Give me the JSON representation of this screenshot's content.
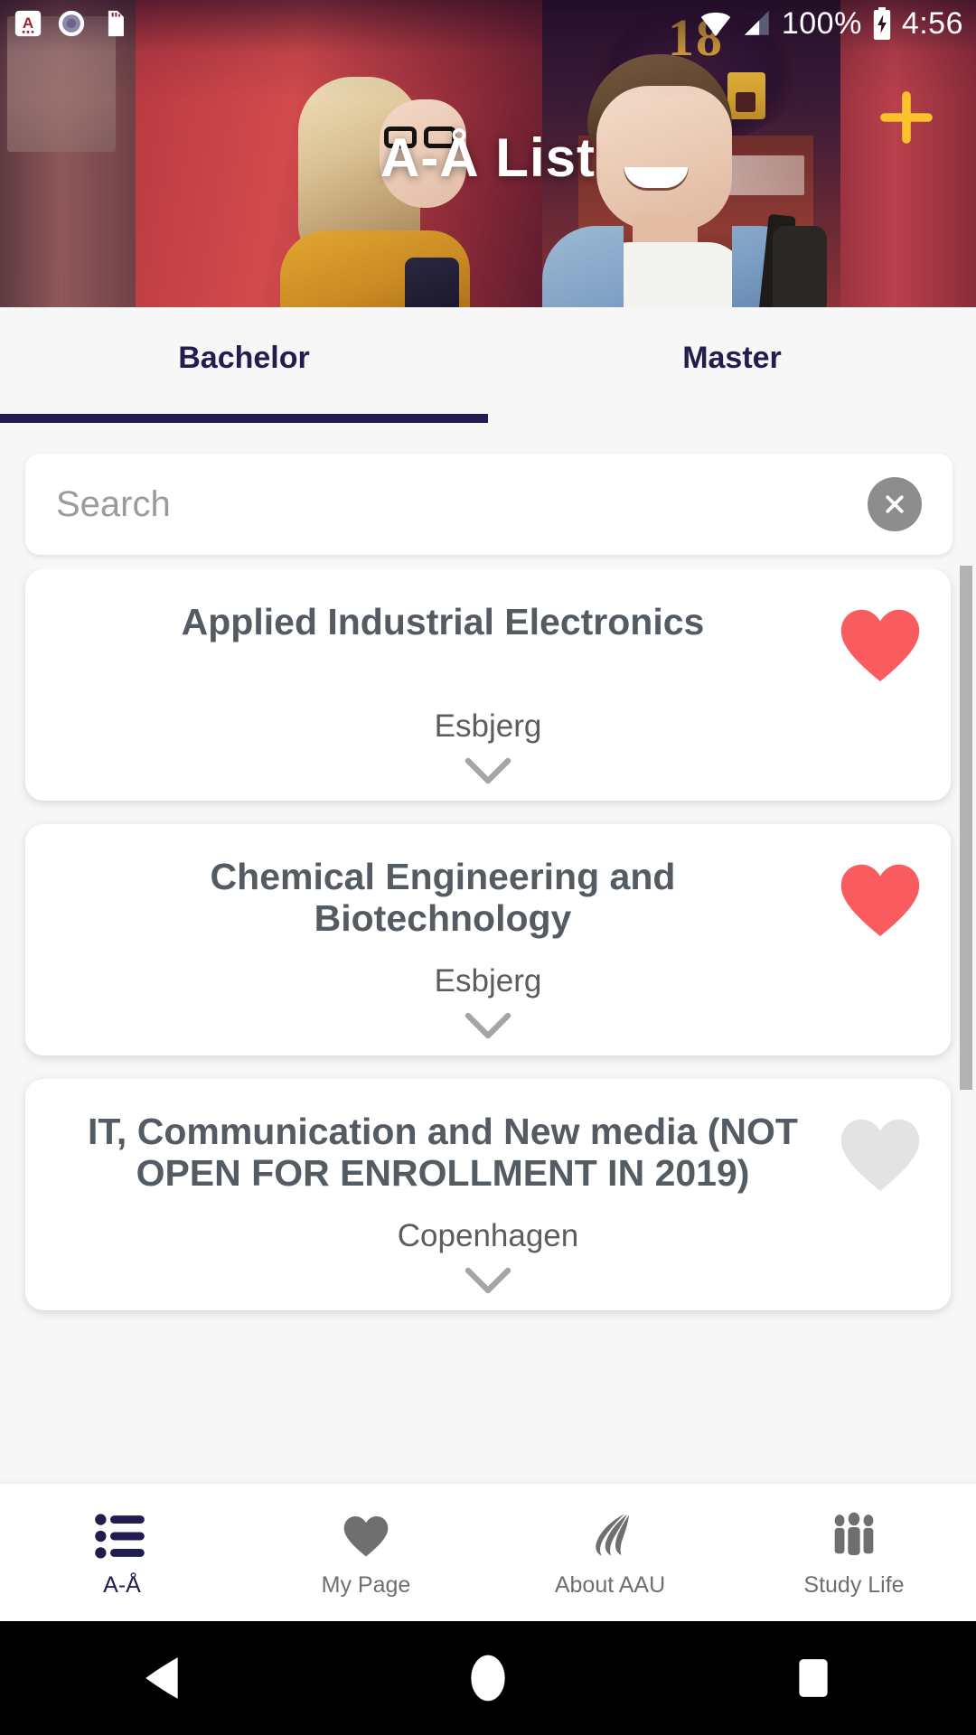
{
  "status_bar": {
    "icons": [
      "app-notification-icon",
      "record-circle-icon",
      "sd-card-icon"
    ],
    "wifi_icon": "wifi-icon",
    "signal_icon": "cellular-signal-icon",
    "battery_percent": "100%",
    "battery_icon": "battery-charging-icon",
    "time": "4:56"
  },
  "hero": {
    "title": "A-Å List",
    "add_button": "add-icon",
    "add_color": "#fcc22e",
    "sign_number": "18"
  },
  "tabs": {
    "items": [
      {
        "label": "Bachelor",
        "active": true
      },
      {
        "label": "Master",
        "active": false
      }
    ],
    "indicator_color": "#211d4e"
  },
  "search": {
    "value": "",
    "placeholder": "Search",
    "clear_icon": "clear-icon"
  },
  "list": {
    "cards": [
      {
        "title": "Applied Industrial Electronics",
        "location": "Esbjerg",
        "favorite": true,
        "heart_icon": "heart-filled-icon",
        "expand_icon": "chevron-down-icon"
      },
      {
        "title": "Chemical Engineering and Biotechnology",
        "location": "Esbjerg",
        "favorite": true,
        "heart_icon": "heart-filled-icon",
        "expand_icon": "chevron-down-icon"
      },
      {
        "title": "IT, Communication and New media (NOT OPEN FOR ENROLLMENT IN 2019)",
        "location": "Copenhagen",
        "favorite": false,
        "heart_icon": "heart-outline-icon",
        "expand_icon": "chevron-down-icon"
      }
    ],
    "favorite_color": "#fa5b5f",
    "unfavorite_color": "#e3e3e3"
  },
  "bottom_nav": {
    "items": [
      {
        "label": "A-Å",
        "icon": "list-icon",
        "active": true
      },
      {
        "label": "My Page",
        "icon": "heart-icon",
        "active": false
      },
      {
        "label": "About AAU",
        "icon": "aau-logo-icon",
        "active": false
      },
      {
        "label": "Study Life",
        "icon": "people-icon",
        "active": false
      }
    ]
  },
  "android_nav": {
    "back": "back-triangle-icon",
    "home": "home-circle-icon",
    "recents": "recents-square-icon"
  }
}
